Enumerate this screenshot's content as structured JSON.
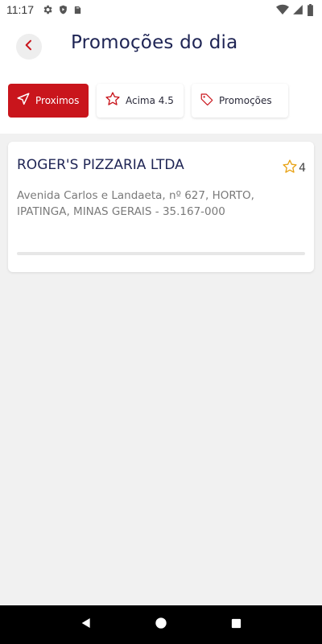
{
  "status_bar": {
    "time": "11:17",
    "left_icons": [
      "settings-icon",
      "shield-play-icon",
      "sd-card-icon"
    ],
    "right_icons": [
      "wifi-icon",
      "signal-icon",
      "battery-icon"
    ]
  },
  "header": {
    "back_icon": "chevron-left-icon",
    "title": "Promoções do dia"
  },
  "filters": [
    {
      "label": "Proximos",
      "icon": "navigation-arrow-icon",
      "active": true
    },
    {
      "label": "Acima 4.5",
      "icon": "star-outline-icon",
      "active": false
    },
    {
      "label": "Promoções",
      "icon": "tag-icon",
      "active": false
    }
  ],
  "results": [
    {
      "name": "ROGER'S PIZZARIA LTDA",
      "rating": "4",
      "address": "Avenida Carlos e Landaeta, nº 627, HORTO, IPATINGA, MINAS GERAIS - 35.167-000"
    }
  ],
  "nav_bar": {
    "icons": [
      "back-triangle-icon",
      "home-circle-icon",
      "recents-square-icon"
    ]
  },
  "colors": {
    "accent": "#c9151c",
    "title": "#1e2454",
    "star": "#e8a317"
  }
}
